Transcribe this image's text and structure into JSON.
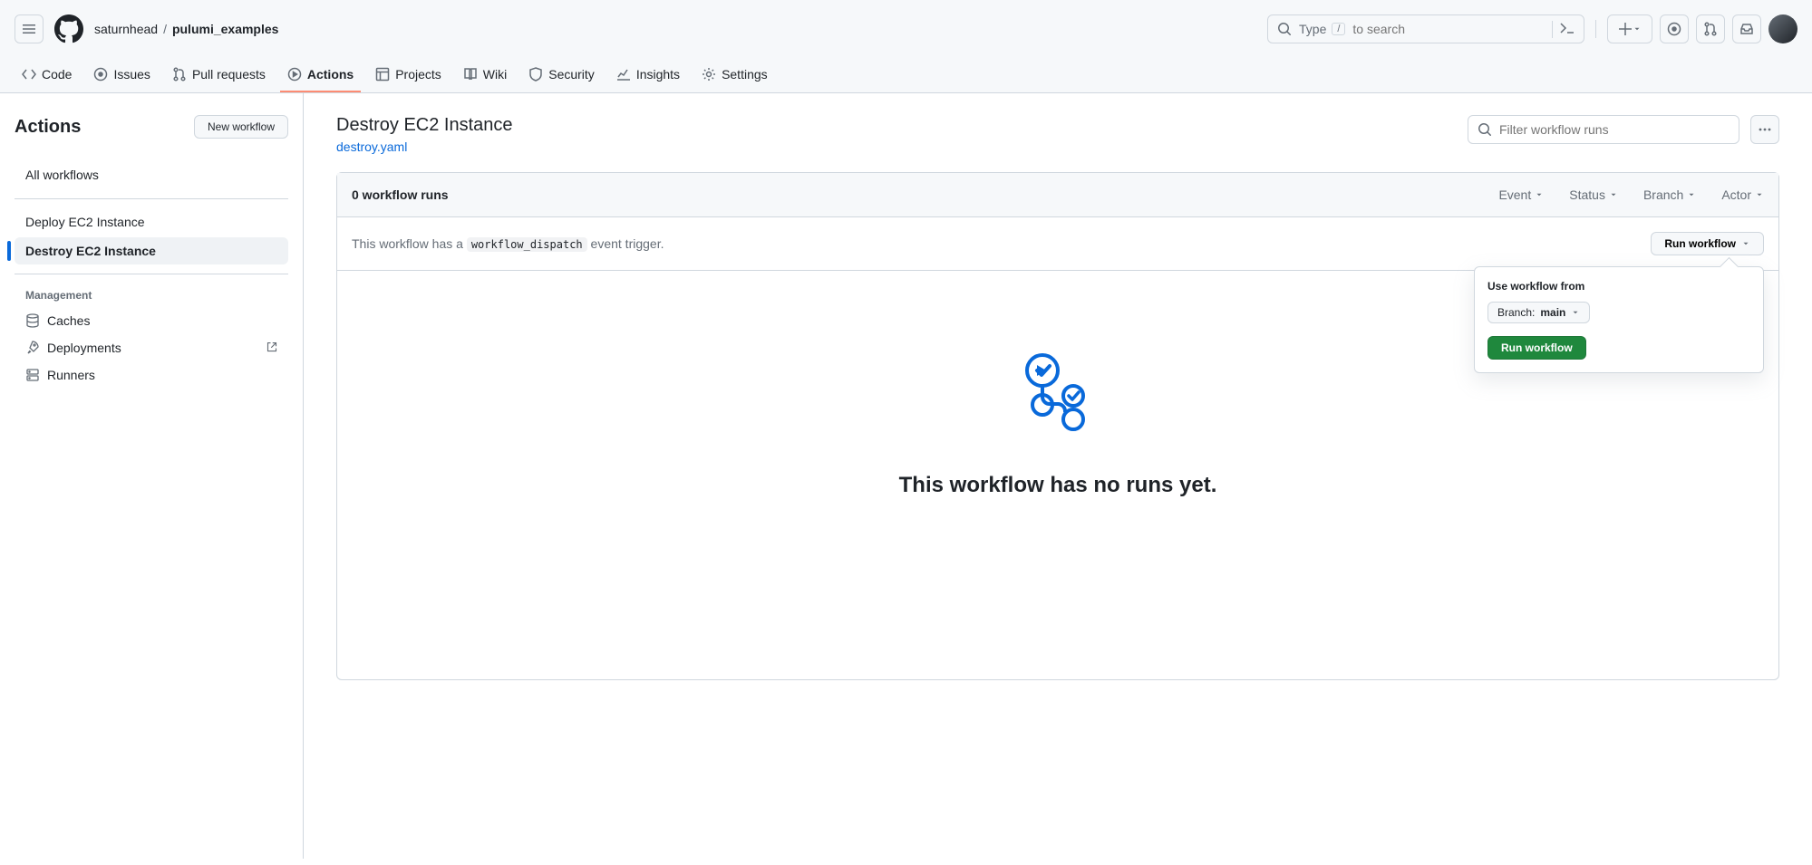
{
  "header": {
    "owner": "saturnhead",
    "repo": "pulumi_examples",
    "search_type": "Type",
    "search_placeholder": "to search"
  },
  "repo_nav": {
    "code": "Code",
    "issues": "Issues",
    "pulls": "Pull requests",
    "actions": "Actions",
    "projects": "Projects",
    "wiki": "Wiki",
    "security": "Security",
    "insights": "Insights",
    "settings": "Settings"
  },
  "sidebar": {
    "title": "Actions",
    "new_workflow": "New workflow",
    "all_workflows": "All workflows",
    "workflows": [
      {
        "label": "Deploy EC2 Instance",
        "active": false
      },
      {
        "label": "Destroy EC2 Instance",
        "active": true
      }
    ],
    "management_title": "Management",
    "management": {
      "caches": "Caches",
      "deployments": "Deployments",
      "runners": "Runners"
    }
  },
  "content": {
    "title": "Destroy EC2 Instance",
    "yaml_link": "destroy.yaml",
    "filter_placeholder": "Filter workflow runs",
    "runs_count": "0 workflow runs",
    "filters": {
      "event": "Event",
      "status": "Status",
      "branch": "Branch",
      "actor": "Actor"
    },
    "dispatch_prefix": "This workflow has a ",
    "dispatch_code": "workflow_dispatch",
    "dispatch_suffix": " event trigger.",
    "run_workflow_btn": "Run workflow",
    "dropdown": {
      "label": "Use workflow from",
      "branch_prefix": "Branch: ",
      "branch_value": "main",
      "submit": "Run workflow"
    },
    "empty": "This workflow has no runs yet."
  }
}
